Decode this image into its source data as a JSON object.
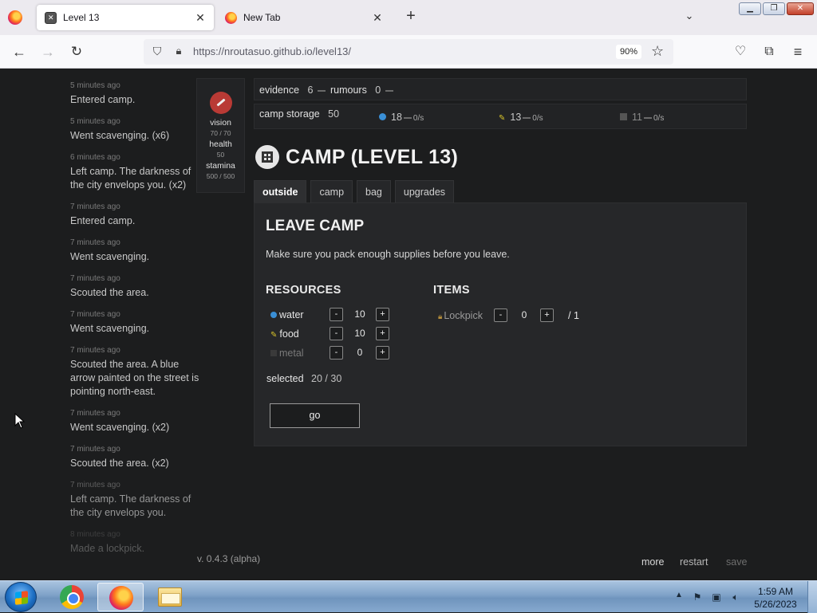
{
  "browser": {
    "tabs": [
      {
        "label": "Level 13",
        "active": true
      },
      {
        "label": "New Tab",
        "active": false
      }
    ],
    "url": "https://nroutasuo.github.io/level13/",
    "zoom": "90%"
  },
  "log": [
    {
      "time": "5 minutes ago",
      "msg": "Entered camp."
    },
    {
      "time": "5 minutes ago",
      "msg": "Went scavenging. (x6)"
    },
    {
      "time": "6 minutes ago",
      "msg": "Left camp. The darkness of the city envelops you. (x2)"
    },
    {
      "time": "7 minutes ago",
      "msg": "Entered camp."
    },
    {
      "time": "7 minutes ago",
      "msg": "Went scavenging."
    },
    {
      "time": "7 minutes ago",
      "msg": "Scouted the area."
    },
    {
      "time": "7 minutes ago",
      "msg": "Went scavenging."
    },
    {
      "time": "7 minutes ago",
      "msg": "Scouted the area. A blue arrow painted on the street is pointing north-east."
    },
    {
      "time": "7 minutes ago",
      "msg": "Went scavenging. (x2)"
    },
    {
      "time": "7 minutes ago",
      "msg": "Scouted the area. (x2)"
    },
    {
      "time": "7 minutes ago",
      "msg": "Left camp. The darkness of the city envelops you."
    },
    {
      "time": "8 minutes ago",
      "msg": "Made a lockpick."
    }
  ],
  "stats": {
    "vision_label": "vision",
    "vision_val": "70 / 70",
    "health_label": "health",
    "health_val": "50",
    "stamina_label": "stamina",
    "stamina_val": "500 / 500"
  },
  "topbar": {
    "evidence_label": "evidence",
    "evidence_val": "6",
    "rumours_label": "rumours",
    "rumours_val": "0",
    "storage_label": "camp storage",
    "storage_val": "50",
    "water_val": "18",
    "water_rate": "0/s",
    "food_val": "13",
    "food_rate": "0/s",
    "metal_val": "11",
    "metal_rate": "0/s"
  },
  "camp": {
    "title": "CAMP (LEVEL 13)",
    "tabs": [
      "outside",
      "camp",
      "bag",
      "upgrades"
    ],
    "active_tab": "outside"
  },
  "outside": {
    "heading": "LEAVE CAMP",
    "description": "Make sure you pack enough supplies before you leave.",
    "resources_heading": "RESOURCES",
    "items_heading": "ITEMS",
    "resources": [
      {
        "name": "water",
        "value": "10"
      },
      {
        "name": "food",
        "value": "10"
      },
      {
        "name": "metal",
        "value": "0"
      }
    ],
    "items": [
      {
        "name": "Lockpick",
        "value": "0",
        "max": "/ 1"
      }
    ],
    "selected_label": "selected",
    "selected_val": "20 / 30",
    "go_label": "go",
    "minus": "-",
    "plus": "+"
  },
  "footer": {
    "version": "v. 0.4.3 (alpha)",
    "more": "more",
    "restart": "restart",
    "save": "save"
  },
  "taskbar": {
    "time": "1:59 AM",
    "date": "5/26/2023"
  }
}
